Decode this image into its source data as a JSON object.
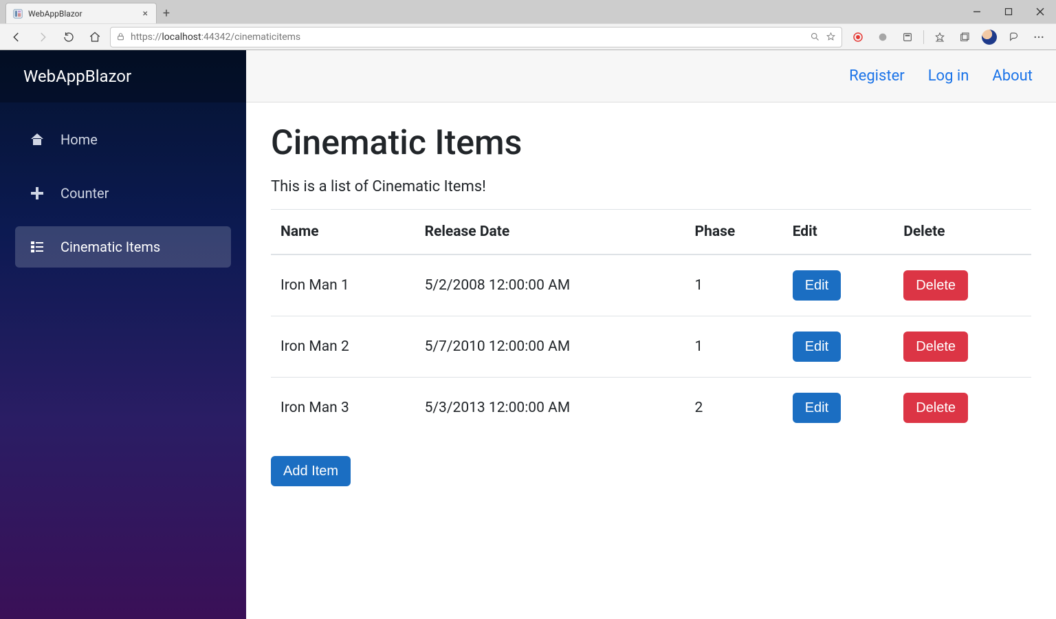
{
  "browser": {
    "tab_title": "WebAppBlazor",
    "url_prefix": "https://",
    "url_host": "localhost",
    "url_port": ":44342",
    "url_path": "/cinematicitems"
  },
  "sidebar": {
    "brand": "WebAppBlazor",
    "items": [
      {
        "label": "Home",
        "icon": "home-icon",
        "active": false
      },
      {
        "label": "Counter",
        "icon": "plus-icon",
        "active": false
      },
      {
        "label": "Cinematic Items",
        "icon": "list-icon",
        "active": true
      }
    ]
  },
  "topbar": {
    "register": "Register",
    "login": "Log in",
    "about": "About"
  },
  "main": {
    "heading": "Cinematic Items",
    "subheading": "This is a list of Cinematic Items!",
    "columns": {
      "name": "Name",
      "release": "Release Date",
      "phase": "Phase",
      "edit": "Edit",
      "delete": "Delete"
    },
    "rows": [
      {
        "name": "Iron Man 1",
        "release": "5/2/2008 12:00:00 AM",
        "phase": "1"
      },
      {
        "name": "Iron Man 2",
        "release": "5/7/2010 12:00:00 AM",
        "phase": "1"
      },
      {
        "name": "Iron Man 3",
        "release": "5/3/2013 12:00:00 AM",
        "phase": "2"
      }
    ],
    "edit_label": "Edit",
    "delete_label": "Delete",
    "add_label": "Add Item"
  }
}
